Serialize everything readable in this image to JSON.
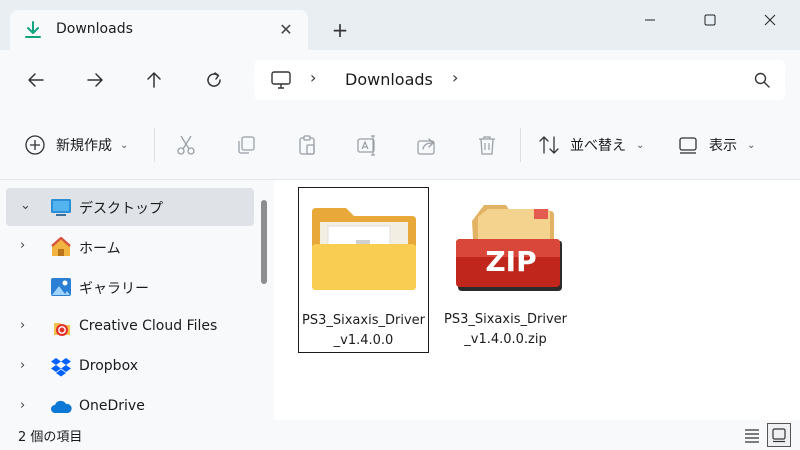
{
  "tab": {
    "title": "Downloads",
    "icon": "download-icon"
  },
  "window": {
    "controls": [
      "minimize",
      "maximize",
      "close"
    ]
  },
  "address": {
    "location": "Downloads",
    "root_icon": "this-pc-icon"
  },
  "toolbar": {
    "new_label": "新規作成",
    "sort_label": "並べ替え",
    "view_label": "表示",
    "actions": [
      "cut",
      "copy",
      "paste",
      "rename",
      "share",
      "delete"
    ]
  },
  "sidebar": {
    "items": [
      {
        "label": "デスクトップ",
        "icon": "desktop-icon",
        "expanded": true,
        "selected": true
      },
      {
        "label": "ホーム",
        "icon": "home-icon"
      },
      {
        "label": "ギャラリー",
        "icon": "gallery-icon"
      },
      {
        "label": "Creative Cloud Files",
        "icon": "creative-cloud-icon"
      },
      {
        "label": "Dropbox",
        "icon": "dropbox-icon"
      },
      {
        "label": "OneDrive",
        "icon": "onedrive-icon"
      }
    ]
  },
  "files": [
    {
      "name": "PS3_Sixaxis_Driver_v1.4.0.0",
      "type": "folder",
      "selected": true
    },
    {
      "name": "PS3_Sixaxis_Driver_v1.4.0.0.zip",
      "type": "zip",
      "badge": "ZIP"
    }
  ],
  "status": {
    "item_count": "2 個の項目",
    "view_mode": "large-icons"
  },
  "colors": {
    "accent": "#0f7b6c",
    "folder": "#f4c542",
    "zip_red": "#c0261c"
  }
}
